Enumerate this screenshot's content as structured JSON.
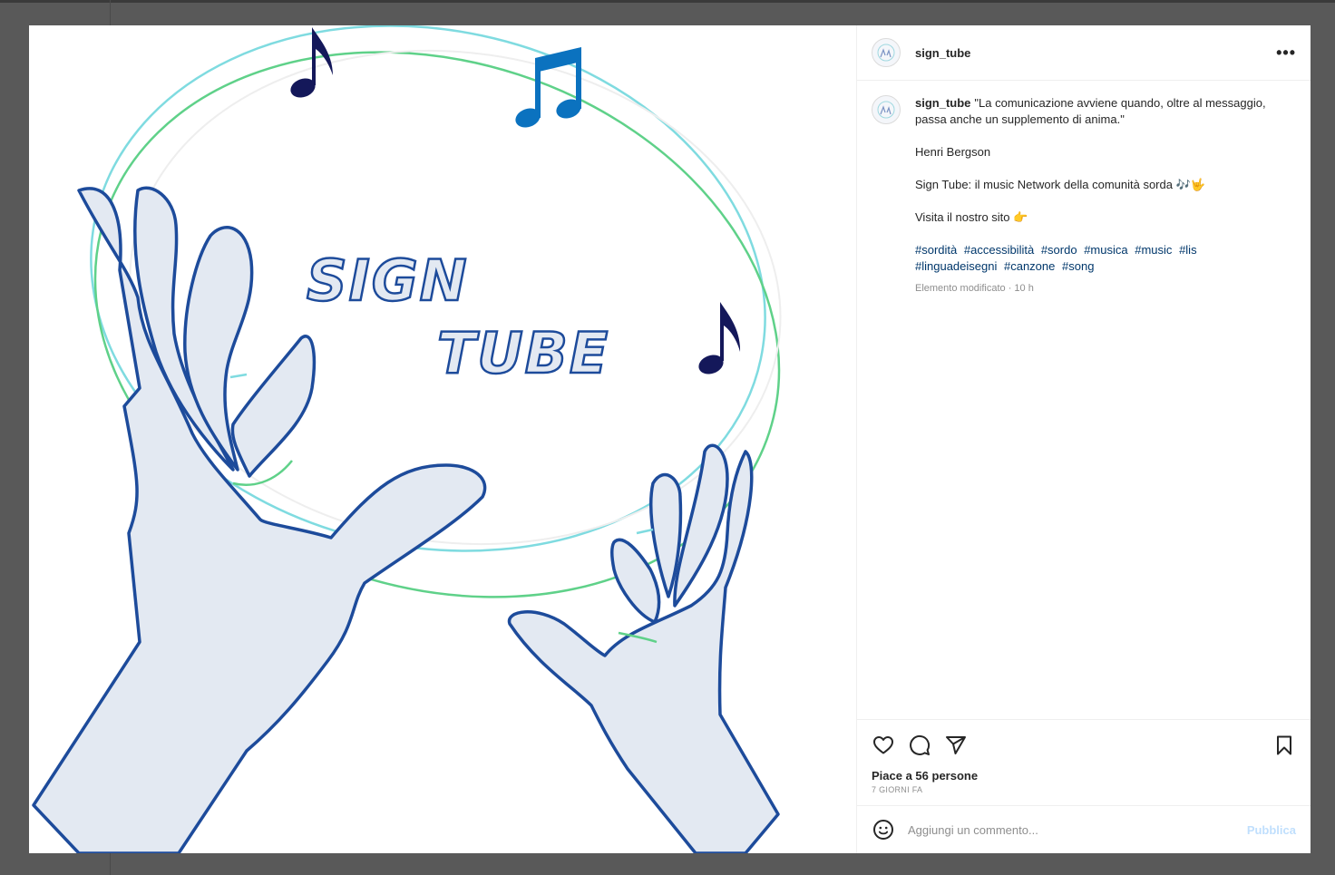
{
  "post": {
    "username": "sign_tube",
    "image": {
      "title_line1": "SIGN",
      "title_line2": "TUBE"
    },
    "caption": {
      "username": "sign_tube",
      "quote": "\"La comunicazione avviene quando, oltre al messaggio, passa anche un supplemento di anima.\"",
      "author": "Henri Bergson",
      "line3": "Sign Tube: il music Network della comunità sorda 🎶🤟",
      "line4": "Visita il nostro sito 👉",
      "hashtags": [
        "#sordità",
        "#accessibilità",
        "#sordo",
        "#musica",
        "#music",
        "#lis",
        "#linguadeisegni",
        "#canzone",
        "#song"
      ],
      "meta": "Elemento modificato · 10 h"
    },
    "likes_text": "Piace a 56 persone",
    "date_text": "7 GIORNI FA",
    "comment_placeholder": "Aggiungi un commento...",
    "publish_label": "Pubblica",
    "more_label": "•••"
  },
  "icons": {
    "more": "more-horizontal-icon",
    "like": "heart-icon",
    "comment": "comment-icon",
    "share": "paper-plane-icon",
    "save": "bookmark-icon",
    "emoji": "smiley-icon"
  },
  "colors": {
    "hand_stroke": "#1d4b9b",
    "hand_fill": "#e3e9f2",
    "note_dark": "#14185a",
    "note_blue": "#0b72bf",
    "ring_cyan": "#7fdbe0",
    "ring_green": "#5fd189",
    "link": "#00376b"
  }
}
